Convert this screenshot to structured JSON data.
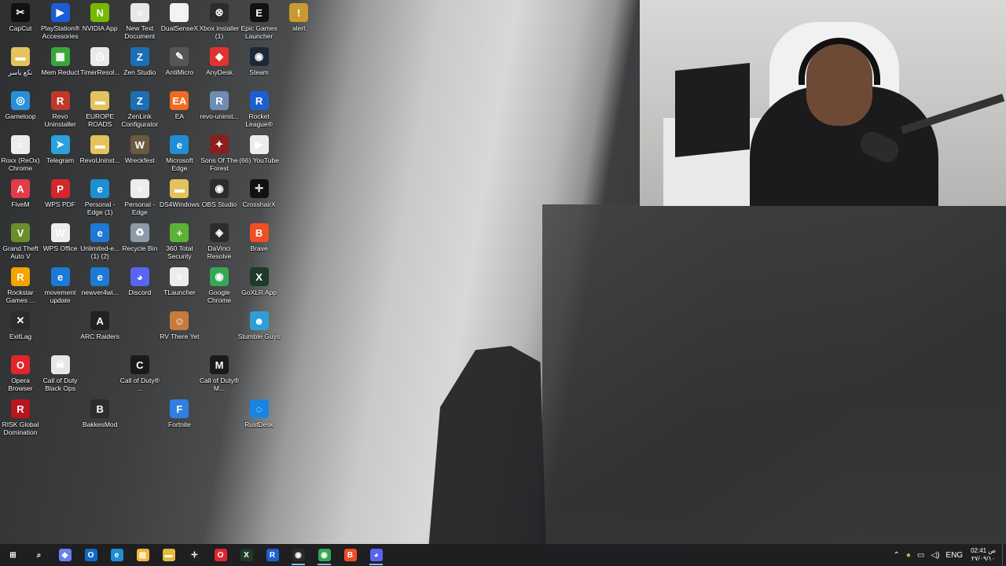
{
  "desktop": {
    "icons": [
      {
        "label": "CapCut",
        "color": "#111111",
        "glyph": "✂",
        "col": 0,
        "row": 0
      },
      {
        "label": "PlayStation® Accessories",
        "color": "#1f5bd6",
        "glyph": "▶",
        "col": 1,
        "row": 0
      },
      {
        "label": "NVIDIA App",
        "color": "#76b900",
        "glyph": "N",
        "col": 2,
        "row": 0
      },
      {
        "label": "New Text Document",
        "color": "#e8e8e8",
        "glyph": "≡",
        "col": 3,
        "row": 0
      },
      {
        "label": "DualSenseX",
        "color": "#f2f2f2",
        "glyph": "□",
        "col": 4,
        "row": 0
      },
      {
        "label": "Xbox installer (1)",
        "color": "#2c2c2c",
        "glyph": "⊗",
        "col": 5,
        "row": 0
      },
      {
        "label": "Epic Games Launcher",
        "color": "#111111",
        "glyph": "E",
        "col": 6,
        "row": 0
      },
      {
        "label": "alert",
        "color": "#c99a2e",
        "glyph": "!",
        "col": 7,
        "row": 0
      },
      {
        "label": "نكع ياسر",
        "color": "#e5c35c",
        "glyph": "▬",
        "col": 0,
        "row": 1
      },
      {
        "label": "Mem Reduct",
        "color": "#3aa63a",
        "glyph": "▦",
        "col": 1,
        "row": 1
      },
      {
        "label": "TimerResol...",
        "color": "#e9e9e9",
        "glyph": "◷",
        "col": 2,
        "row": 1
      },
      {
        "label": "Zen Studio",
        "color": "#1c6fb5",
        "glyph": "Z",
        "col": 3,
        "row": 1
      },
      {
        "label": "AntiMicro",
        "color": "#555555",
        "glyph": "✎",
        "col": 4,
        "row": 1
      },
      {
        "label": "AnyDesk",
        "color": "#e0322f",
        "glyph": "◆",
        "col": 5,
        "row": 1
      },
      {
        "label": "Steam",
        "color": "#1b2838",
        "glyph": "◉",
        "col": 6,
        "row": 1
      },
      {
        "label": "Gameloop",
        "color": "#2a8fd8",
        "glyph": "◎",
        "col": 0,
        "row": 2
      },
      {
        "label": "Revo Uninstaller",
        "color": "#c0392b",
        "glyph": "R",
        "col": 1,
        "row": 2
      },
      {
        "label": "EUROPE ROADS",
        "color": "#e5c35c",
        "glyph": "▬",
        "col": 2,
        "row": 2
      },
      {
        "label": "ZenLink Configurator",
        "color": "#1c6fb5",
        "glyph": "Z",
        "col": 3,
        "row": 2
      },
      {
        "label": "EA",
        "color": "#f26a21",
        "glyph": "EA",
        "col": 4,
        "row": 2
      },
      {
        "label": "revo-uninst...",
        "color": "#6f8cb5",
        "glyph": "R",
        "col": 5,
        "row": 2
      },
      {
        "label": "Rocket League®",
        "color": "#1e5fd0",
        "glyph": "R",
        "col": 6,
        "row": 2
      },
      {
        "label": "Roxx (ReOx) Chrome",
        "color": "#ececec",
        "glyph": "≡",
        "col": 0,
        "row": 3
      },
      {
        "label": "Telegram",
        "color": "#2aa1da",
        "glyph": "➤",
        "col": 1,
        "row": 3
      },
      {
        "label": "RevoUninst...",
        "color": "#e5c35c",
        "glyph": "▬",
        "col": 2,
        "row": 3
      },
      {
        "label": "Wreckfest",
        "color": "#6b5a3e",
        "glyph": "W",
        "col": 3,
        "row": 3
      },
      {
        "label": "Microsoft Edge",
        "color": "#1e8fd4",
        "glyph": "e",
        "col": 4,
        "row": 3
      },
      {
        "label": "Sons Of The Forest",
        "color": "#8b1e1e",
        "glyph": "✦",
        "col": 5,
        "row": 3
      },
      {
        "label": "(66) YouTube",
        "color": "#ececec",
        "glyph": "▶",
        "col": 6,
        "row": 3
      },
      {
        "label": "FiveM",
        "color": "#e23c4a",
        "glyph": "A",
        "col": 0,
        "row": 4
      },
      {
        "label": "WPS PDF",
        "color": "#d2272b",
        "glyph": "P",
        "col": 1,
        "row": 4
      },
      {
        "label": "Personal - Edge (1)",
        "color": "#1e8fd4",
        "glyph": "e",
        "col": 2,
        "row": 4
      },
      {
        "label": "Personal - Edge",
        "color": "#ececec",
        "glyph": "≡",
        "col": 3,
        "row": 4
      },
      {
        "label": "DS4Windows",
        "color": "#e5c35c",
        "glyph": "▬",
        "col": 4,
        "row": 4
      },
      {
        "label": "OBS Studio",
        "color": "#2b2b2b",
        "glyph": "◉",
        "col": 5,
        "row": 4
      },
      {
        "label": "CrosshairX",
        "color": "#111111",
        "glyph": "✛",
        "col": 6,
        "row": 4
      },
      {
        "label": "Grand Theft Auto V",
        "color": "#6a8f2a",
        "glyph": "V",
        "col": 0,
        "row": 5
      },
      {
        "label": "WPS Office",
        "color": "#ececec",
        "glyph": "W",
        "col": 1,
        "row": 5
      },
      {
        "label": "Unlimited-e... (1) (2)",
        "color": "#1c7ad6",
        "glyph": "e",
        "col": 2,
        "row": 5
      },
      {
        "label": "Recycle Bin",
        "color": "#8a9aa8",
        "glyph": "♻",
        "col": 3,
        "row": 5
      },
      {
        "label": "360 Total Security",
        "color": "#5bb335",
        "glyph": "+",
        "col": 4,
        "row": 5
      },
      {
        "label": "DaVinci Resolve",
        "color": "#2c2c2c",
        "glyph": "◈",
        "col": 5,
        "row": 5
      },
      {
        "label": "Brave",
        "color": "#f04e23",
        "glyph": "B",
        "col": 6,
        "row": 5
      },
      {
        "label": "Rockstar Games ...",
        "color": "#f4a300",
        "glyph": "R",
        "col": 0,
        "row": 6
      },
      {
        "label": "movement update",
        "color": "#1c7ad6",
        "glyph": "e",
        "col": 1,
        "row": 6
      },
      {
        "label": "newver4wi...",
        "color": "#1c7ad6",
        "glyph": "e",
        "col": 2,
        "row": 6
      },
      {
        "label": "Discord",
        "color": "#5865f2",
        "glyph": "◕",
        "col": 3,
        "row": 6
      },
      {
        "label": "TLauncher",
        "color": "#ececec",
        "glyph": "≡",
        "col": 4,
        "row": 6
      },
      {
        "label": "Google Chrome",
        "color": "#34a853",
        "glyph": "◉",
        "col": 5,
        "row": 6
      },
      {
        "label": "GoXLR App",
        "color": "#1f3a2a",
        "glyph": "X",
        "col": 6,
        "row": 6
      },
      {
        "label": "ExitLag",
        "color": "#2c2c2c",
        "glyph": "✕",
        "col": 0,
        "row": 7
      },
      {
        "label": "ARC Raiders",
        "color": "#222222",
        "glyph": "A",
        "col": 2,
        "row": 7
      },
      {
        "label": "RV There Yet",
        "color": "#c77a3a",
        "glyph": "☺",
        "col": 4,
        "row": 7
      },
      {
        "label": "Stumble Guys",
        "color": "#2e9fd6",
        "glyph": "☻",
        "col": 6,
        "row": 7
      },
      {
        "label": "Opera Browser",
        "color": "#e0262c",
        "glyph": "O",
        "col": 0,
        "row": 8
      },
      {
        "label": "Call of Duty Black Ops",
        "color": "#e6e6e6",
        "glyph": "☠",
        "col": 1,
        "row": 8
      },
      {
        "label": "Call of Duty® ...",
        "color": "#1a1a1a",
        "glyph": "C",
        "col": 3,
        "row": 8
      },
      {
        "label": "Call of Duty® M...",
        "color": "#1a1a1a",
        "glyph": "M",
        "col": 5,
        "row": 8
      },
      {
        "label": "RISK Global Domination",
        "color": "#b8151d",
        "glyph": "R",
        "col": 0,
        "row": 9
      },
      {
        "label": "BakkesMod",
        "color": "#2c2c2c",
        "glyph": "B",
        "col": 2,
        "row": 9
      },
      {
        "label": "Fortnite",
        "color": "#2f7fe0",
        "glyph": "F",
        "col": 4,
        "row": 9
      },
      {
        "label": "RustDesk",
        "color": "#1a85e0",
        "glyph": "◌",
        "col": 6,
        "row": 9
      }
    ]
  },
  "taskbar": {
    "items": [
      {
        "name": "start-button",
        "glyph": "⊞",
        "color": "#1f1f22",
        "active": false
      },
      {
        "name": "search-button",
        "glyph": "⌕",
        "color": "#1f1f22",
        "active": false
      },
      {
        "name": "copilot-app",
        "glyph": "◆",
        "color": "#6a7ff0",
        "active": false
      },
      {
        "name": "outlook-app",
        "glyph": "O",
        "color": "#1467c5",
        "active": false
      },
      {
        "name": "edge-app",
        "glyph": "e",
        "color": "#1e8fd4",
        "active": false
      },
      {
        "name": "store-app",
        "glyph": "▤",
        "color": "#f2b632",
        "active": false
      },
      {
        "name": "file-explorer-app",
        "glyph": "▬",
        "color": "#e5b93a",
        "active": false
      },
      {
        "name": "crosshairx-app",
        "glyph": "✛",
        "color": "#222222",
        "active": false
      },
      {
        "name": "opera-app",
        "glyph": "O",
        "color": "#e0262c",
        "active": false
      },
      {
        "name": "goxlr-app",
        "glyph": "X",
        "color": "#1f3a2a",
        "active": false
      },
      {
        "name": "rocket-league-app",
        "glyph": "R",
        "color": "#1e5fd0",
        "active": false
      },
      {
        "name": "obs-app",
        "glyph": "◉",
        "color": "#2b2b2b",
        "active": true
      },
      {
        "name": "chrome-app",
        "glyph": "◉",
        "color": "#34a853",
        "active": true
      },
      {
        "name": "brave-app",
        "glyph": "B",
        "color": "#f04e23",
        "active": false
      },
      {
        "name": "discord-app",
        "glyph": "◕",
        "color": "#5865f2",
        "active": true
      }
    ],
    "tray": {
      "chevron": "⌃",
      "language": "ENG",
      "time": "02:41 ص",
      "date": "٢٧/٠٩/١٠"
    }
  }
}
